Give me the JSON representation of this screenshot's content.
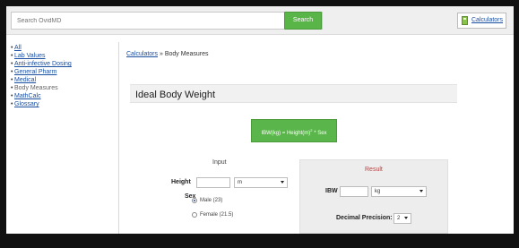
{
  "header": {
    "search_placeholder": "Search OvidMD",
    "search_button": "Search",
    "calculators_link": "Calculators",
    "calculator_icon": "calculator-icon"
  },
  "sidebar": {
    "items": [
      {
        "label": "All",
        "link": true
      },
      {
        "label": "Lab Values",
        "link": true
      },
      {
        "label": "Anti-infective Dosing",
        "link": true
      },
      {
        "label": "General Pharm",
        "link": true
      },
      {
        "label": "Medical",
        "link": true
      },
      {
        "label": "Body Measures",
        "link": false
      },
      {
        "label": "MathCalc",
        "link": true
      },
      {
        "label": "Glossary",
        "link": true
      }
    ]
  },
  "breadcrumb": {
    "root": "Calculators",
    "separator": "»",
    "current": "Body Measures"
  },
  "calculator": {
    "title": "Ideal Body Weight",
    "formula_prefix": "IBW(kg) = Height(m)",
    "formula_exponent": "2",
    "formula_suffix": " * Sex"
  },
  "input": {
    "heading": "Input",
    "height_label": "Height",
    "height_value": "",
    "height_unit": "m",
    "sex_label": "Sex",
    "sex_options": [
      "Male (23)",
      "Female (21.5)"
    ],
    "sex_selected": "Male (23)"
  },
  "result": {
    "heading": "Result",
    "ibw_label": "IBW",
    "ibw_value": "",
    "ibw_unit": "kg",
    "precision_label": "Decimal Precision:",
    "precision_value": "2"
  },
  "colors": {
    "accent_green": "#5ab64a",
    "link_blue": "#1a4fa0",
    "result_heading": "#b04848"
  }
}
